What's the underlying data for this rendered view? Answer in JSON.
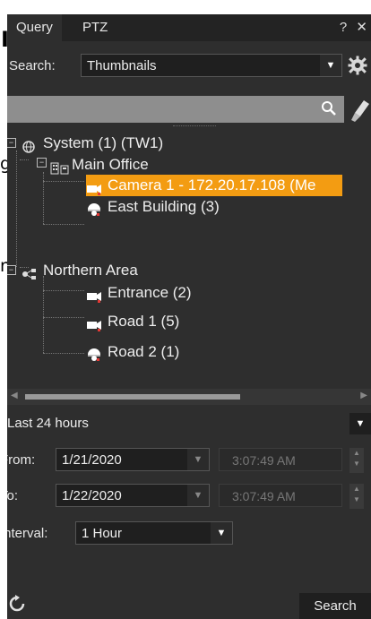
{
  "tabs": [
    {
      "label": "Query"
    },
    {
      "label": "PTZ"
    }
  ],
  "window_buttons": {
    "help": "?",
    "close": "✕"
  },
  "search": {
    "label": "Search:",
    "value": "Thumbnails"
  },
  "tree": {
    "nodes": [
      {
        "label": "System (1) (TW1)",
        "icon": "globe-icon"
      },
      {
        "label": "Main Office",
        "icon": "building-icon"
      },
      {
        "label": "Camera 1 - 172.20.17.108 (Me",
        "icon": "camera-icon",
        "selected": true
      },
      {
        "label": "East Building (3)",
        "icon": "dome-camera-icon"
      },
      {
        "label": "Northern Area",
        "icon": "network-icon"
      },
      {
        "label": "Entrance (2)",
        "icon": "camera-icon"
      },
      {
        "label": "Road 1 (5)",
        "icon": "camera-icon"
      },
      {
        "label": "Road 2 (1)",
        "icon": "dome-camera-icon"
      }
    ]
  },
  "range": {
    "value": "Last 24 hours"
  },
  "from": {
    "label": "From:",
    "date": "1/21/2020",
    "time": "3:07:49 AM"
  },
  "to": {
    "label": "To:",
    "date": "1/22/2020",
    "time": "3:07:49 AM"
  },
  "interval": {
    "label": "Interval:",
    "value": "1 Hour"
  },
  "search_button": {
    "label": "Search"
  },
  "background_fragments": [
    "I",
    "g",
    "n"
  ]
}
